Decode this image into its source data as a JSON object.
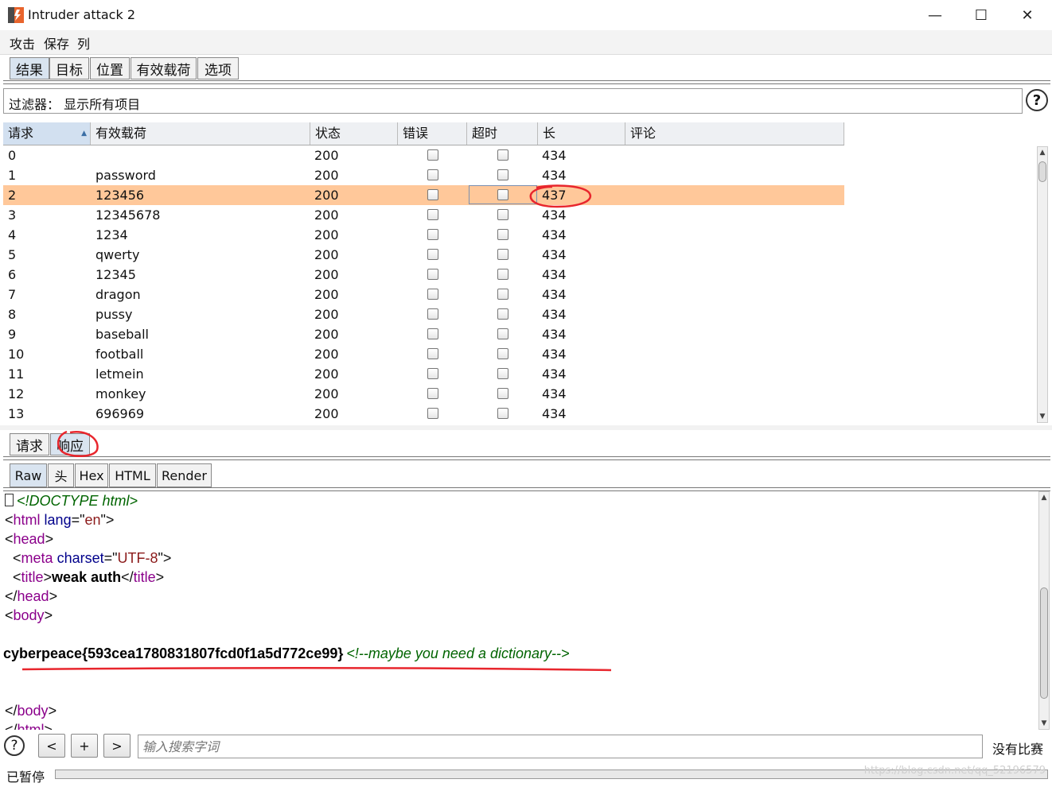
{
  "window": {
    "title": "Intruder attack 2",
    "minimize": "—",
    "maximize": "☐",
    "close": "✕"
  },
  "menu": [
    "攻击",
    "保存",
    "列"
  ],
  "tabs": [
    "结果",
    "目标",
    "位置",
    "有效载荷",
    "选项"
  ],
  "filter": {
    "text": "过滤器： 显示所有项目",
    "help": "?"
  },
  "table": {
    "columns": [
      "请求",
      "有效载荷",
      "状态",
      "错误",
      "超时",
      "长",
      "评论"
    ],
    "sorted_column": "请求",
    "selected_row": 2,
    "rows": [
      {
        "req": "0",
        "payload": "",
        "status": "200",
        "error": false,
        "timeout": false,
        "length": "434",
        "comment": ""
      },
      {
        "req": "1",
        "payload": "password",
        "status": "200",
        "error": false,
        "timeout": false,
        "length": "434",
        "comment": ""
      },
      {
        "req": "2",
        "payload": "123456",
        "status": "200",
        "error": false,
        "timeout": false,
        "length": "437",
        "comment": ""
      },
      {
        "req": "3",
        "payload": "12345678",
        "status": "200",
        "error": false,
        "timeout": false,
        "length": "434",
        "comment": ""
      },
      {
        "req": "4",
        "payload": "1234",
        "status": "200",
        "error": false,
        "timeout": false,
        "length": "434",
        "comment": ""
      },
      {
        "req": "5",
        "payload": "qwerty",
        "status": "200",
        "error": false,
        "timeout": false,
        "length": "434",
        "comment": ""
      },
      {
        "req": "6",
        "payload": "12345",
        "status": "200",
        "error": false,
        "timeout": false,
        "length": "434",
        "comment": ""
      },
      {
        "req": "7",
        "payload": "dragon",
        "status": "200",
        "error": false,
        "timeout": false,
        "length": "434",
        "comment": ""
      },
      {
        "req": "8",
        "payload": "pussy",
        "status": "200",
        "error": false,
        "timeout": false,
        "length": "434",
        "comment": ""
      },
      {
        "req": "9",
        "payload": "baseball",
        "status": "200",
        "error": false,
        "timeout": false,
        "length": "434",
        "comment": ""
      },
      {
        "req": "10",
        "payload": "football",
        "status": "200",
        "error": false,
        "timeout": false,
        "length": "434",
        "comment": ""
      },
      {
        "req": "11",
        "payload": "letmein",
        "status": "200",
        "error": false,
        "timeout": false,
        "length": "434",
        "comment": ""
      },
      {
        "req": "12",
        "payload": "monkey",
        "status": "200",
        "error": false,
        "timeout": false,
        "length": "434",
        "comment": ""
      },
      {
        "req": "13",
        "payload": "696969",
        "status": "200",
        "error": false,
        "timeout": false,
        "length": "434",
        "comment": ""
      }
    ]
  },
  "detail_tabs": [
    "请求",
    "响应"
  ],
  "detail_active": "响应",
  "view_tabs": [
    "Raw",
    "头",
    "Hex",
    "HTML",
    "Render"
  ],
  "view_active": "Raw",
  "response": {
    "l1_bom": "",
    "l1": "<!DOCTYPE html>",
    "l2": [
      "<",
      "html",
      " ",
      "lang",
      "=\"",
      "en",
      "\">"
    ],
    "l3": [
      "<",
      "head",
      ">"
    ],
    "l4": [
      "  <",
      "meta",
      " ",
      "charset",
      "=\"",
      "UTF-8",
      "\">"
    ],
    "l5": [
      "  <",
      "title",
      ">",
      "weak auth",
      "</",
      "title",
      ">"
    ],
    "l6": [
      "</",
      "head",
      ">"
    ],
    "l7": [
      "<",
      "body",
      ">"
    ],
    "l9": [
      "cyberpeace{593cea1780831807fcd0f1a5d772ce99}",
      "<!--maybe you need a dictionary-->"
    ],
    "l12": [
      "</",
      "body",
      ">"
    ],
    "l13": [
      "</",
      "html",
      ">"
    ]
  },
  "search": {
    "help": "?",
    "prev": "<",
    "add": "+",
    "next": ">",
    "placeholder": "输入搜索字词",
    "result": "没有比赛"
  },
  "status": {
    "text": "已暂停",
    "watermark": "https://blog.csdn.net/qq_52196579"
  },
  "colors": {
    "selected_row": "#ffc89a",
    "annotation": "#e8262d",
    "active_tab": "#d9e4f0"
  }
}
